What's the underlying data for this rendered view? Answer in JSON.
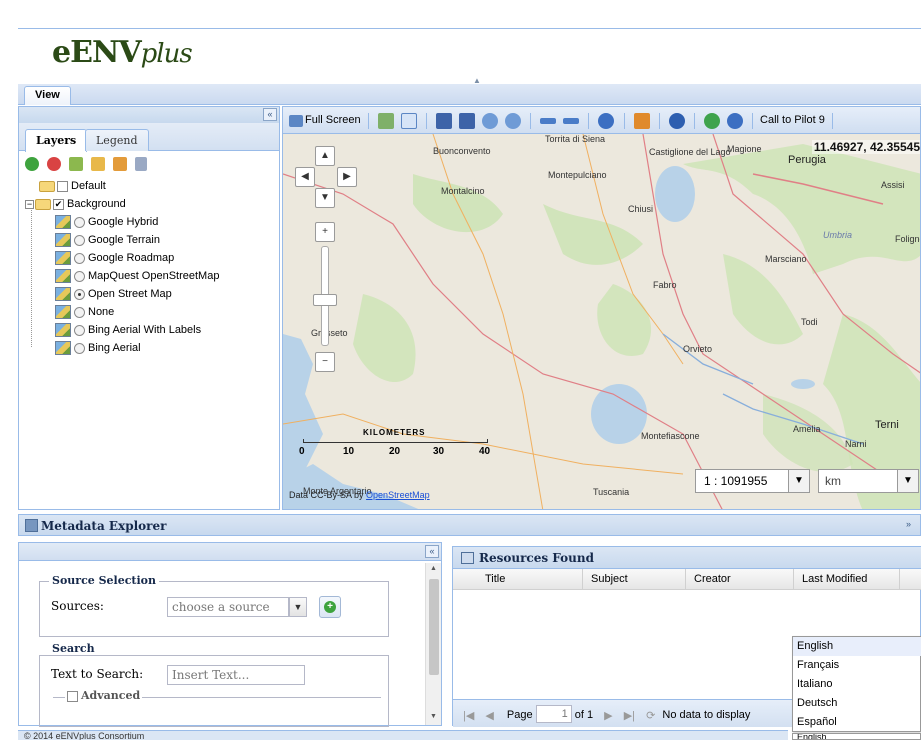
{
  "header": {
    "logo_main": "eENV",
    "logo_plus": "plus"
  },
  "tabs": {
    "view_label": "View"
  },
  "layers_panel": {
    "tab_layers": "Layers",
    "tab_legend": "Legend",
    "collapse_glyph": "«",
    "tree": {
      "default_label": "Default",
      "background_label": "Background",
      "layers": [
        {
          "label": "Google Hybrid",
          "selected": false
        },
        {
          "label": "Google Terrain",
          "selected": false
        },
        {
          "label": "Google Roadmap",
          "selected": false
        },
        {
          "label": "MapQuest OpenStreetMap",
          "selected": false
        },
        {
          "label": "Open Street Map",
          "selected": true
        },
        {
          "label": "None",
          "selected": false
        },
        {
          "label": "Bing Aerial With Labels",
          "selected": false
        },
        {
          "label": "Bing Aerial",
          "selected": false
        }
      ]
    }
  },
  "map_toolbar": {
    "full_screen_label": "Full Screen",
    "call_to_pilot_label": "Call to Pilot 9"
  },
  "map": {
    "coordinates": "11.46927, 42.35545",
    "scale_value": "1 : 1091955",
    "unit_value": "km",
    "scalebar_title": "KILOMETERS",
    "scalebar_ticks": [
      "0",
      "10",
      "20",
      "30",
      "40"
    ],
    "attribution_prefix": "Data CC-By-SA by",
    "attribution_link": "OpenStreetMap",
    "places": [
      {
        "name": "Buonconvento"
      },
      {
        "name": "Torrita di Siena"
      },
      {
        "name": "Castiglione del Lago"
      },
      {
        "name": "Magione"
      },
      {
        "name": "Perugia"
      },
      {
        "name": "Montepulciano"
      },
      {
        "name": "Montalcino"
      },
      {
        "name": "Assisi"
      },
      {
        "name": "Chiusi"
      },
      {
        "name": "Umbria"
      },
      {
        "name": "Foligno"
      },
      {
        "name": "Marsciano"
      },
      {
        "name": "Fabro"
      },
      {
        "name": "Todi"
      },
      {
        "name": "Grosseto"
      },
      {
        "name": "Orvieto"
      },
      {
        "name": "Amelia"
      },
      {
        "name": "Montefiascone"
      },
      {
        "name": "Terni"
      },
      {
        "name": "Narni"
      },
      {
        "name": "Tuscania"
      },
      {
        "name": "Monte Argentario"
      }
    ]
  },
  "metadata_explorer": {
    "title": "Metadata Explorer",
    "source_selection_legend": "Source Selection",
    "sources_label": "Sources:",
    "sources_placeholder": "choose a source",
    "search_legend": "Search",
    "text_to_search_label": "Text to Search:",
    "text_to_search_placeholder": "Insert Text...",
    "advanced_label": "Advanced"
  },
  "resources": {
    "title": "Resources Found",
    "columns": [
      "Title",
      "Subject",
      "Creator",
      "Last Modified"
    ],
    "page_label": "Page",
    "page_value": "1",
    "of_label": "of 1",
    "empty_message": "No data to display"
  },
  "language_menu": {
    "options": [
      "English",
      "Français",
      "Italiano",
      "Deutsch",
      "Español"
    ],
    "current": "English"
  },
  "footer": {
    "copyright": "© 2014 eENVplus Consortium"
  }
}
